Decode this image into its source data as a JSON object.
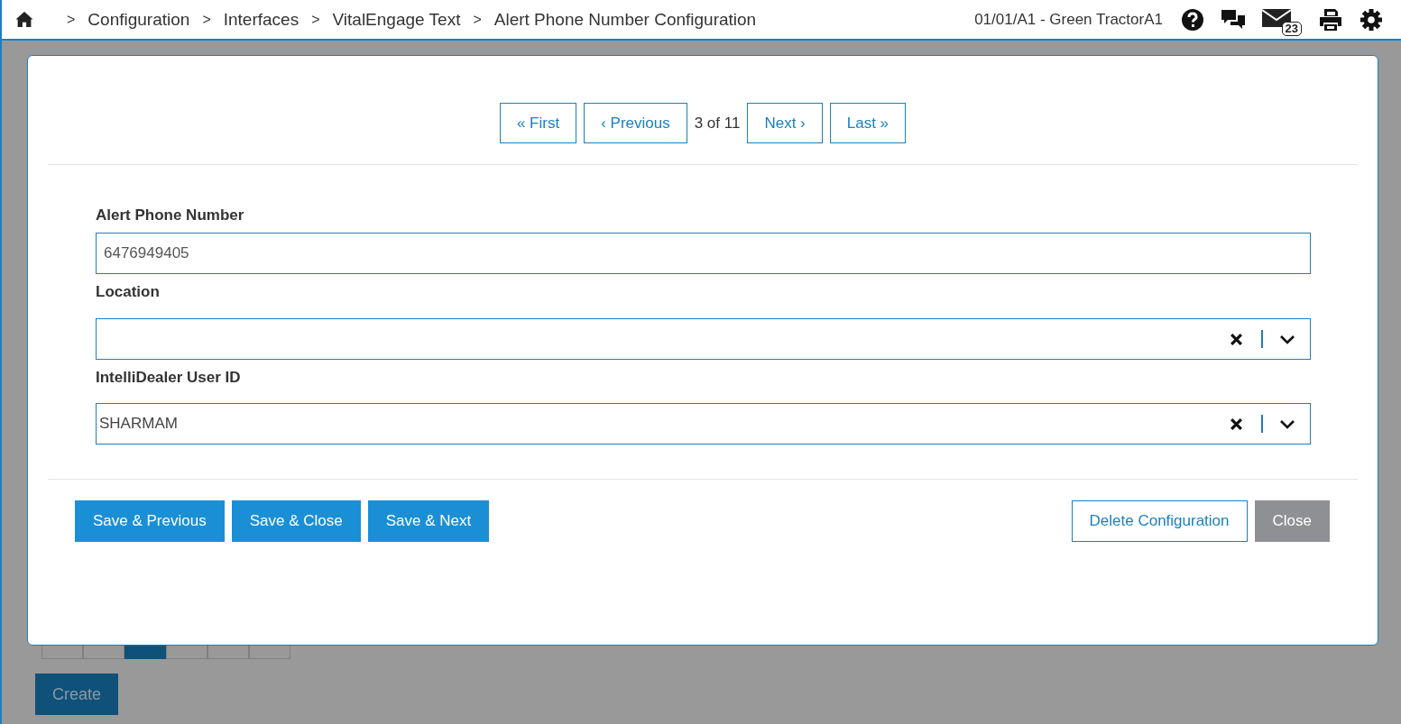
{
  "breadcrumb": [
    {
      "separator": ">",
      "label": "Configuration"
    },
    {
      "separator": ">",
      "label": "Interfaces"
    },
    {
      "separator": ">",
      "label": "VitalEngage Text"
    },
    {
      "separator": ">",
      "label": "Alert Phone Number Configuration"
    }
  ],
  "location": "01/01/A1 - Green TractorA1",
  "mail_count": "23",
  "background": {
    "pager_cells": [
      {
        "selected": false
      },
      {
        "selected": false
      },
      {
        "selected": true
      },
      {
        "selected": false
      },
      {
        "selected": false
      },
      {
        "selected": false
      }
    ],
    "create_button": "Create"
  },
  "dialog": {
    "pager": {
      "first": "« First",
      "previous": "‹ Previous",
      "position": "3 of 11",
      "next": "Next ›",
      "last": "Last »"
    },
    "fields": [
      {
        "kind": "text",
        "label": "Alert Phone Number",
        "value": "6476949405"
      },
      {
        "kind": "select",
        "label": "Location"
      },
      {
        "kind": "select",
        "label": "IntelliDealer User ID",
        "value": "SHARMAM"
      }
    ],
    "buttons": [
      {
        "kind": "primary",
        "label": "Save & Previous"
      },
      {
        "kind": "primary",
        "label": "Save & Close"
      },
      {
        "kind": "primary",
        "label": "Save & Next"
      },
      {
        "kind": "outline",
        "label": "Delete Configuration"
      },
      {
        "kind": "muted",
        "label": "Close"
      }
    ]
  }
}
